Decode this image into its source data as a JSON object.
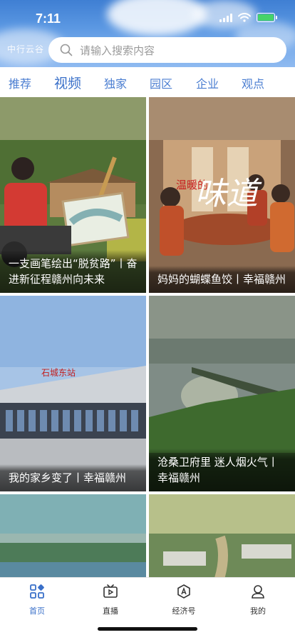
{
  "status_bar": {
    "time": "7:11"
  },
  "header": {
    "logo_text": "中行云谷",
    "search_placeholder": "请输入搜索内容"
  },
  "tabs": [
    {
      "label": "推荐",
      "active": false
    },
    {
      "label": "视频",
      "active": true
    },
    {
      "label": "独家",
      "active": false
    },
    {
      "label": "园区",
      "active": false
    },
    {
      "label": "企业",
      "active": false
    },
    {
      "label": "观点",
      "active": false
    }
  ],
  "cards": [
    {
      "title": "一支画笔绘出“脱贫路”丨奋进新征程赣州向未来"
    },
    {
      "title": "妈妈的蝴蝶鱼饺丨幸福赣州"
    },
    {
      "title": "我的家乡变了丨幸福赣州"
    },
    {
      "title": "沧桑卫府里 迷人烟火气丨幸福赣州"
    },
    {
      "title": ""
    },
    {
      "title": ""
    }
  ],
  "image_text": {
    "card2_warm": "温暖的",
    "card2_taste": "味道",
    "card3_sign": "石城东站"
  },
  "bottom_nav": [
    {
      "label": "首页",
      "icon": "grid-icon",
      "active": true
    },
    {
      "label": "直播",
      "icon": "tv-play-icon",
      "active": false
    },
    {
      "label": "经济号",
      "icon": "hexagon-a-icon",
      "active": false
    },
    {
      "label": "我的",
      "icon": "person-icon",
      "active": false
    }
  ],
  "colors": {
    "accent": "#3a70c9",
    "tab_text": "#4b7ed1",
    "battery": "#46d36a"
  }
}
